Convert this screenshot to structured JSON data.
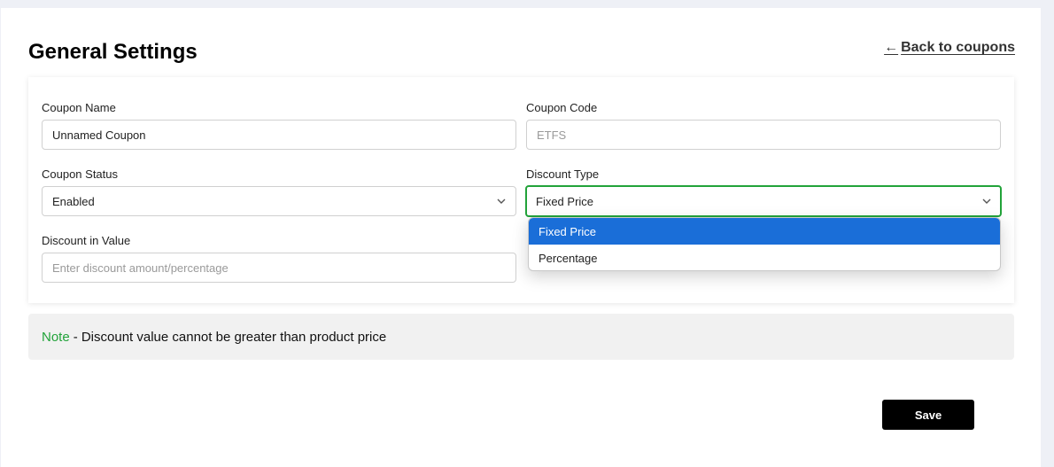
{
  "header": {
    "title": "General Settings",
    "back_link": "Back to coupons",
    "back_icon": "arrow-left-icon"
  },
  "form": {
    "coupon_name": {
      "label": "Coupon Name",
      "value": "Unnamed Coupon"
    },
    "coupon_code": {
      "label": "Coupon Code",
      "placeholder": "ETFS"
    },
    "coupon_status": {
      "label": "Coupon Status",
      "value": "Enabled"
    },
    "discount_type": {
      "label": "Discount Type",
      "value": "Fixed Price",
      "options": [
        "Fixed Price",
        "Percentage"
      ],
      "selected_option": "Fixed Price"
    },
    "discount_value": {
      "label": "Discount in Value",
      "placeholder": "Enter discount amount/percentage"
    }
  },
  "note": {
    "key": "Note",
    "text": "- Discount value cannot be greater than product price"
  },
  "actions": {
    "save_label": "Save"
  },
  "colors": {
    "accent_green": "#22a33a",
    "selected_blue": "#1a6ed8",
    "button_black": "#000000"
  }
}
